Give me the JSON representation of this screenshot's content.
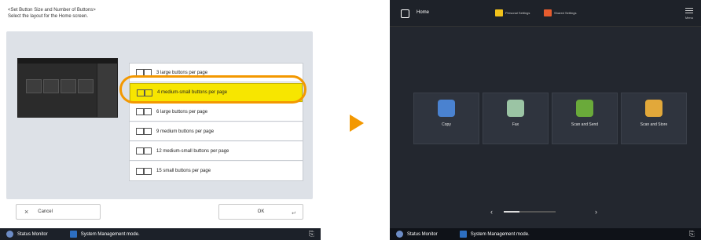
{
  "left": {
    "heading_line1": "<Set Button Size and Number of Buttons>",
    "heading_line2": "Select the layout for the Home screen.",
    "options": [
      "3 large buttons per page",
      "4 medium-small buttons per page",
      "6 large buttons per page",
      "9 medium buttons per page",
      "12 medium-small buttons per page",
      "15 small buttons per page"
    ],
    "selected_index": 1,
    "cancel_label": "Cancel",
    "ok_label": "OK",
    "cancel_icon": "×",
    "enter_icon": "↵"
  },
  "status_bar": {
    "status_monitor": "Status Monitor",
    "system_mode": "System Management mode.",
    "end_icon": "⎘"
  },
  "right": {
    "title": "Home",
    "personal_settings": "Personal Settings",
    "shared_settings": "Shared Settings",
    "menu_label": "Menu",
    "tiles": [
      {
        "label": "Copy",
        "color": "#4a82d0"
      },
      {
        "label": "Fax",
        "color": "#9bc4a4"
      },
      {
        "label": "Scan and Send",
        "color": "#6aaa3a"
      },
      {
        "label": "Scan and Store",
        "color": "#e2a83a"
      }
    ],
    "pager_prev": "‹",
    "pager_next": "›",
    "pager_progress": 0.3
  },
  "colors": {
    "selected": "#f7e600",
    "highlight_ring": "#f39800",
    "arrow": "#f39800"
  }
}
